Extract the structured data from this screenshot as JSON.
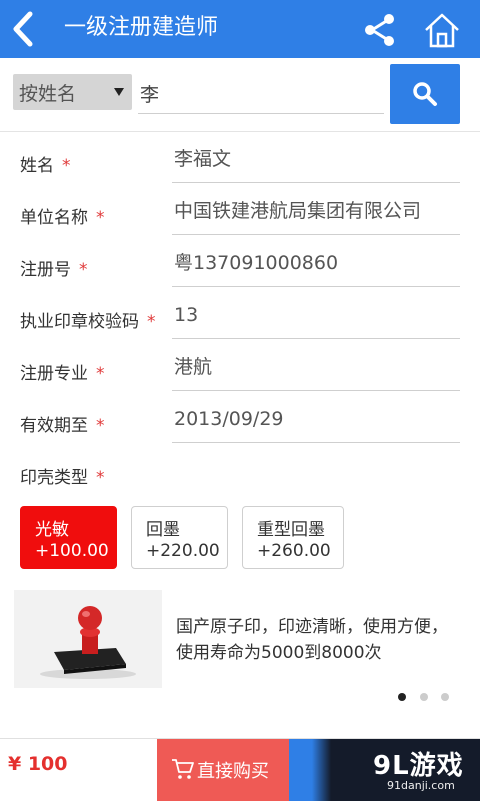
{
  "header": {
    "title": "一级注册建造师",
    "icons": [
      "back-arrow-icon",
      "share-icon",
      "home-icon"
    ],
    "color": "#2f7fe6"
  },
  "search": {
    "filter_selected": "按姓名",
    "query": "李"
  },
  "form": {
    "rows": [
      {
        "label": "姓名",
        "value": "李福文"
      },
      {
        "label": "单位名称",
        "value": "中国铁建港航局集团有限公司"
      },
      {
        "label": "注册号",
        "value": "粤137091000860"
      },
      {
        "label": "执业印章校验码",
        "value": "13"
      },
      {
        "label": "注册专业",
        "value": "港航"
      },
      {
        "label": "有效期至",
        "value": "2013/09/29"
      }
    ],
    "required_mark": "*",
    "shell_type_label": "印壳类型"
  },
  "shell_options": [
    {
      "name": "光敏",
      "price": "+100.00",
      "selected": true
    },
    {
      "name": "回墨",
      "price": "+220.00",
      "selected": false
    },
    {
      "name": "重型回墨",
      "price": "+260.00",
      "selected": false
    }
  ],
  "product": {
    "description": "国产原子印，印迹清晰，使用方便，使用寿命为5000到8000次",
    "carousel_total": 3,
    "carousel_active": 1
  },
  "footer": {
    "price": "¥ 100",
    "buy_label": "直接购买",
    "watermark": "9L游戏",
    "watermark_site": "91danji.com",
    "accent": "#ef5a55"
  }
}
